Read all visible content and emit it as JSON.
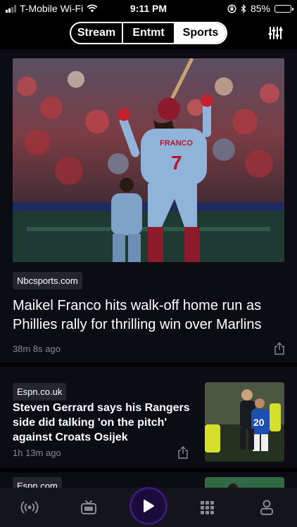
{
  "status_bar": {
    "carrier": "T-Mobile Wi-Fi",
    "time": "9:11 PM",
    "battery": "85%",
    "battery_level": 0.85
  },
  "top_nav": {
    "tabs": [
      {
        "label": "Stream"
      },
      {
        "label": "Entmt"
      },
      {
        "label": "Sports",
        "active": true
      }
    ],
    "filter_icon": "sliders-icon"
  },
  "feed": {
    "hero": {
      "source": "Nbcsports.com",
      "headline": "Maikel Franco hits walk-off home run as Phillies rally for thrilling win over Marlins",
      "time": "38m 8s ago",
      "jersey_name": "FRANCO",
      "jersey_number": "7"
    },
    "story": {
      "source": "Espn.co.uk",
      "headline": "Steven Gerrard says his Rangers side did talking 'on the pitch' against Croats Osijek",
      "time": "1h 13m ago",
      "thumb_number": "20"
    },
    "story3": {
      "source": "Espn.com"
    }
  },
  "bottom_bar": {
    "icons": [
      "radio-icon",
      "tv-icon",
      "play-icon",
      "grid-icon",
      "profile-icon"
    ]
  },
  "colors": {
    "background": "#000000",
    "feed_background": "#0c0c14",
    "accent": "#3a1a78",
    "chip_background": "#24242e",
    "muted_text": "#8a8a94"
  }
}
